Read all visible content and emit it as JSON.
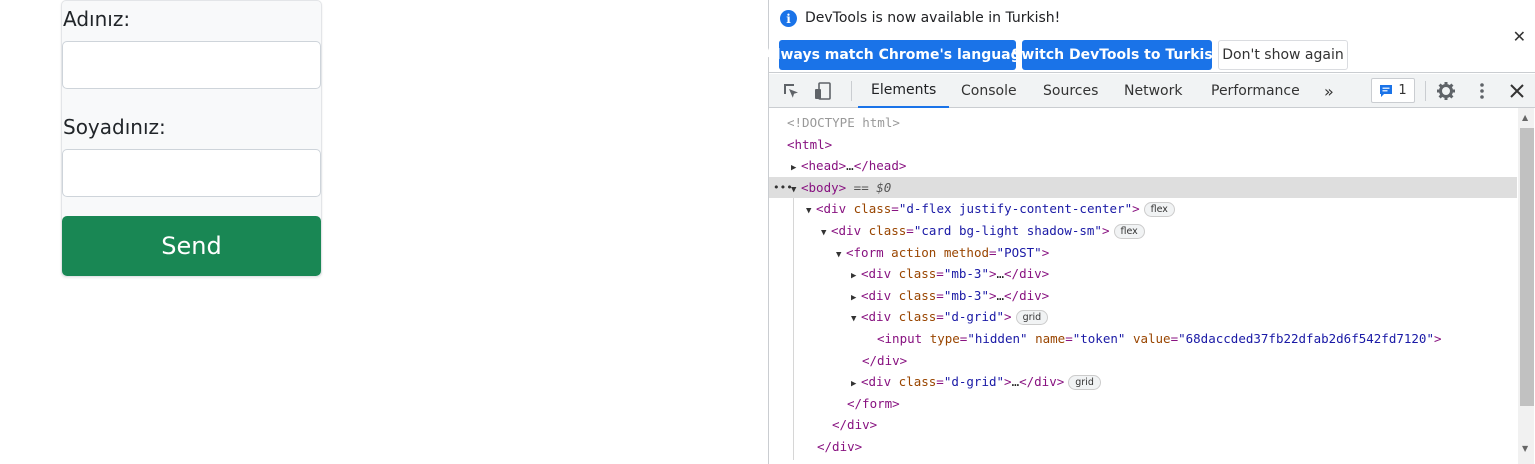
{
  "form": {
    "name_label": "Adınız:",
    "surname_label": "Soyadınız:",
    "name_value": "",
    "surname_value": "",
    "submit_label": "Send"
  },
  "devtools": {
    "infobar": {
      "message": "DevTools is now available in Turkish!",
      "btn_match": "Always match Chrome's language",
      "btn_switch": "Switch DevTools to Turkish",
      "btn_dismiss": "Don't show again"
    },
    "tabs": [
      "Elements",
      "Console",
      "Sources",
      "Network",
      "Performance"
    ],
    "more_tabs": "»",
    "issues_count": "1",
    "dom": {
      "doctype": "<!DOCTYPE html>",
      "html_open": "<html>",
      "head_open": "<head>",
      "head_ellipsis": "…",
      "head_close": "</head>",
      "body_open": "<body>",
      "body_ref": " == $0",
      "div1_open": "<div",
      "div1_class_attr": "class",
      "div1_class_val": "\"d-flex justify-content-center\"",
      "div1_badge": "flex",
      "div2_open": "<div",
      "div2_class_attr": "class",
      "div2_class_val": "\"card bg-light shadow-sm\"",
      "div2_badge": "flex",
      "form_open": "<form",
      "form_action_attr": "action",
      "form_method_attr": "method",
      "form_method_val": "\"POST\"",
      "mb3_a_open": "<div",
      "mb3_a_attr": "class",
      "mb3_a_val": "\"mb-3\"",
      "mb3_a_close": "</div>",
      "mb3_b_open": "<div",
      "mb3_b_attr": "class",
      "mb3_b_val": "\"mb-3\"",
      "mb3_b_close": "</div>",
      "dgrid_a_open": "<div",
      "dgrid_a_attr": "class",
      "dgrid_a_val": "\"d-grid\"",
      "dgrid_a_badge": "grid",
      "input_open": "<input",
      "input_type_attr": "type",
      "input_type_val": "\"hidden\"",
      "input_name_attr": "name",
      "input_name_val": "\"token\"",
      "input_value_attr": "value",
      "input_value_val": "\"68daccded37fb22dfab2d6f542fd7120\"",
      "dgrid_a_close": "</div>",
      "dgrid_b_open": "<div",
      "dgrid_b_attr": "class",
      "dgrid_b_val": "\"d-grid\"",
      "dgrid_b_close": "</div>",
      "dgrid_b_badge": "grid",
      "form_close": "</form>",
      "div2_close": "</div>",
      "div1_close": "</div>",
      "ellipsis": "…"
    }
  }
}
